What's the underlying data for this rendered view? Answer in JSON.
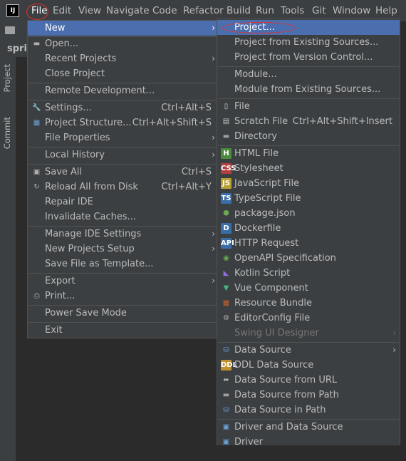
{
  "app_logo": "IJ",
  "menubar": [
    "File",
    "Edit",
    "View",
    "Navigate",
    "Code",
    "Refactor",
    "Build",
    "Run",
    "Tools",
    "Git",
    "Window",
    "Help"
  ],
  "sidebar": {
    "tab_project": "Project",
    "tab_commit": "Commit",
    "behind_text": "sprin"
  },
  "file_menu": {
    "new": "New",
    "open": "Open...",
    "recent": "Recent Projects",
    "close": "Close Project",
    "remote": "Remote Development...",
    "settings": "Settings...",
    "settings_sc": "Ctrl+Alt+S",
    "structure": "Project Structure...",
    "structure_sc": "Ctrl+Alt+Shift+S",
    "props": "File Properties",
    "history": "Local History",
    "save_all": "Save All",
    "save_all_sc": "Ctrl+S",
    "reload": "Reload All from Disk",
    "reload_sc": "Ctrl+Alt+Y",
    "repair": "Repair IDE",
    "invalidate": "Invalidate Caches...",
    "manage": "Manage IDE Settings",
    "new_setup": "New Projects Setup",
    "save_template": "Save File as Template...",
    "export": "Export",
    "print": "Print...",
    "power": "Power Save Mode",
    "exit": "Exit"
  },
  "new_menu": {
    "project": "Project...",
    "existing": "Project from Existing Sources...",
    "vcs": "Project from Version Control...",
    "module": "Module...",
    "module_existing": "Module from Existing Sources...",
    "file": "File",
    "scratch": "Scratch File",
    "scratch_sc": "Ctrl+Alt+Shift+Insert",
    "directory": "Directory",
    "html": "HTML File",
    "stylesheet": "Stylesheet",
    "js": "JavaScript File",
    "ts": "TypeScript File",
    "pkg": "package.json",
    "docker": "Dockerfile",
    "http": "HTTP Request",
    "openapi": "OpenAPI Specification",
    "kotlin": "Kotlin Script",
    "vue": "Vue Component",
    "bundle": "Resource Bundle",
    "editorconfig": "EditorConfig File",
    "swing": "Swing UI Designer",
    "ds": "Data Source",
    "ddl": "DDL Data Source",
    "ds_url": "Data Source from URL",
    "ds_path": "Data Source from Path",
    "ds_in_path": "Data Source in Path",
    "driver_ds": "Driver and Data Source",
    "driver": "Driver"
  },
  "colors": {
    "accent": "#4b6eaf",
    "menu_bg": "#3c3f41",
    "annotation": "#e0342f"
  }
}
